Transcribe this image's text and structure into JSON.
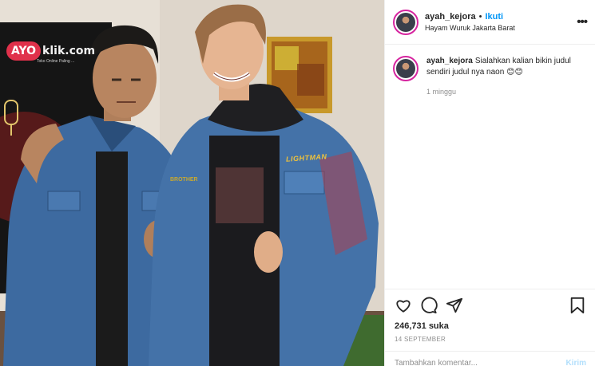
{
  "post": {
    "username": "ayah_kejora",
    "follow_label": "Ikuti",
    "location": "Hayam Wuruk Jakarta Barat",
    "caption": "Sialahkan kalian bikin judul sendiri judul nya naon 😊😊",
    "caption_time": "1 minggu",
    "likes": "246,731 suka",
    "date": "14 SEPTEMBER",
    "comment_placeholder": "Tambahkan komentar...",
    "send_label": "Kirim"
  },
  "photo": {
    "logo_badge": "AYO",
    "logo_text": "klik.com",
    "logo_tagline": "Toko Online Paling ...",
    "jacket_text": "LIGHTMAN",
    "jacket_text_left": "BROTHER"
  },
  "icons": [
    "more-icon",
    "heart-icon",
    "comment-icon",
    "share-icon",
    "bookmark-icon"
  ],
  "colors": {
    "follow": "#0095f6",
    "brand": "#e0314b",
    "send_disabled": "#b2dffc"
  }
}
